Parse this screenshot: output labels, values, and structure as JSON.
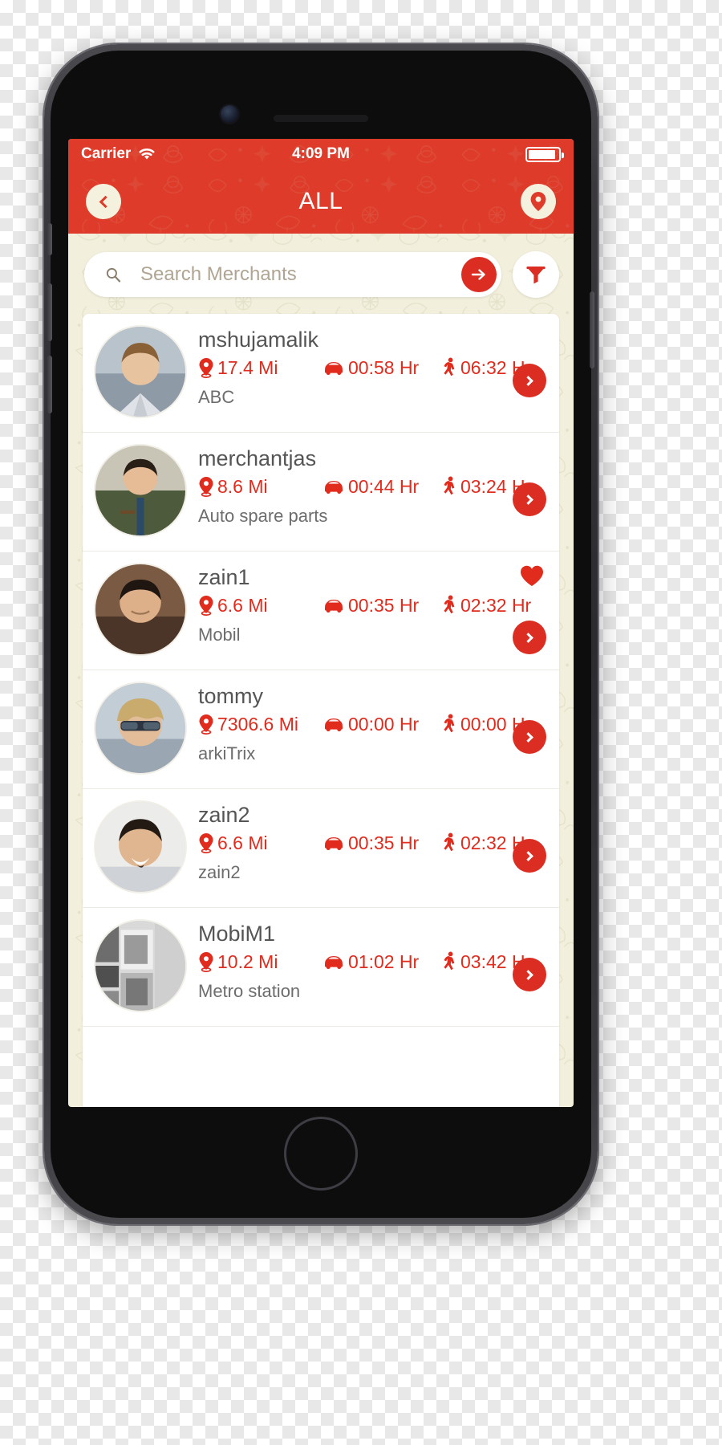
{
  "status_bar": {
    "carrier": "Carrier",
    "wifi_icon": "wifi-icon",
    "time": "4:09 PM",
    "battery_icon": "battery-icon"
  },
  "nav_bar": {
    "back_icon": "chevron-left-icon",
    "title": "ALL",
    "location_icon": "map-pin-icon"
  },
  "search": {
    "search_icon": "search-icon",
    "placeholder": "Search Merchants",
    "value": "",
    "submit_icon": "arrow-right-icon",
    "filter_icon": "funnel-filter-icon"
  },
  "colors": {
    "brand_red": "#df3b2a",
    "accent_red": "#db2d22",
    "metric_red": "#e02b1d",
    "background_cream": "#f2f0dc",
    "card_white": "#ffffff",
    "name_gray": "#555555",
    "sub_gray": "#6d6d6d"
  },
  "icons": {
    "distance": "map-pin-icon",
    "drive": "car-icon",
    "walk": "walking-person-icon",
    "forward": "chevron-right-icon",
    "favorite": "heart-icon"
  },
  "merchants": [
    {
      "name": "mshujamalik",
      "distance": "17.4 Mi",
      "drive_time": "00:58 Hr",
      "walk_time": "06:32 Hr",
      "category": "ABC",
      "favorite": false
    },
    {
      "name": "merchantjas",
      "distance": "8.6 Mi",
      "drive_time": "00:44 Hr",
      "walk_time": "03:24 Hr",
      "category": "Auto spare parts",
      "favorite": false
    },
    {
      "name": "zain1",
      "distance": "6.6 Mi",
      "drive_time": "00:35 Hr",
      "walk_time": "02:32 Hr",
      "category": "Mobil",
      "favorite": true
    },
    {
      "name": "tommy",
      "distance": "7306.6 Mi",
      "drive_time": "00:00 Hr",
      "walk_time": "00:00 Hr",
      "category": "arkiTrix",
      "favorite": false
    },
    {
      "name": "zain2",
      "distance": "6.6 Mi",
      "drive_time": "00:35 Hr",
      "walk_time": "02:32 Hr",
      "category": "zain2",
      "favorite": false
    },
    {
      "name": "MobiM1",
      "distance": "10.2 Mi",
      "drive_time": "01:02 Hr",
      "walk_time": "03:42 Hr",
      "category": "Metro station",
      "favorite": false
    }
  ]
}
